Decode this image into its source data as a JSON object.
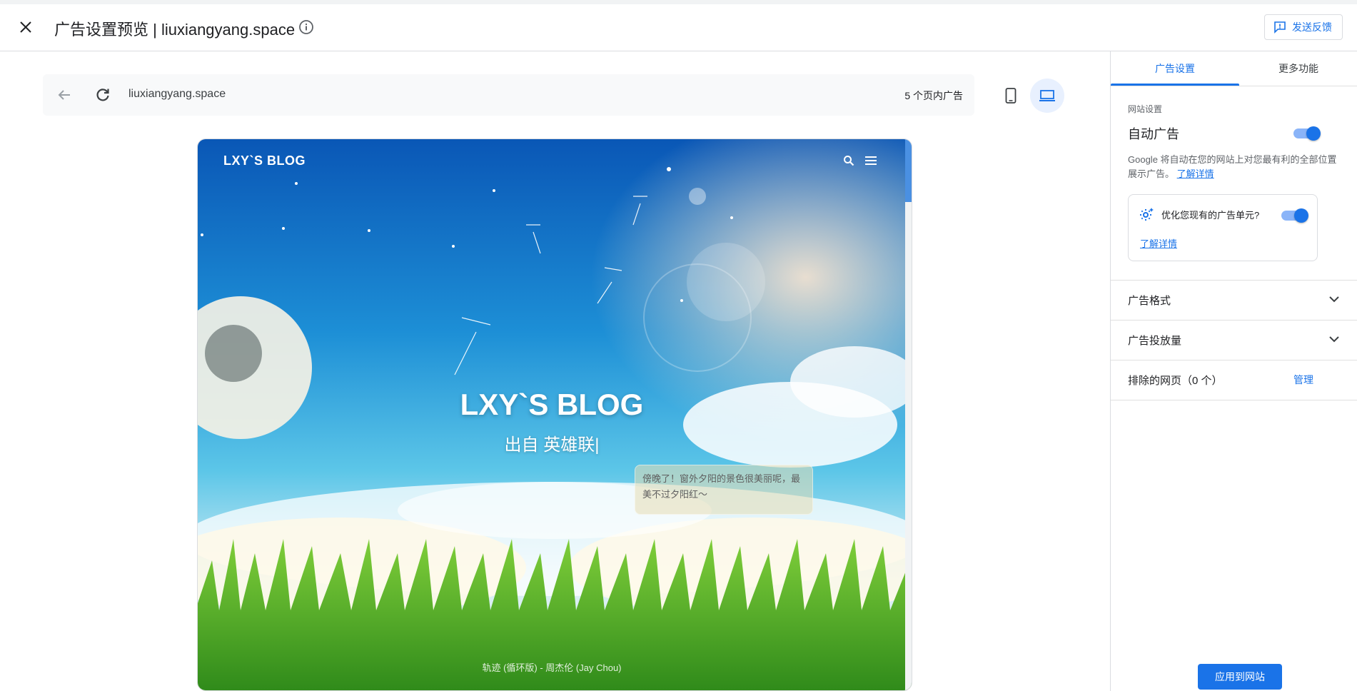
{
  "header": {
    "title": "广告设置预览 | liuxiangyang.space",
    "feedback_label": "发送反馈"
  },
  "preview": {
    "url": "liuxiangyang.space",
    "ad_count": "5 个页内广告",
    "device_selected": "desktop"
  },
  "site": {
    "logo": "LXY`S BLOG",
    "title": "LXY`S BLOG",
    "subtitle": "出自 英雄联|",
    "note": "傍晚了！窗外夕阳的景色很美丽呢，最美不过夕阳红～",
    "music": "轨迹 (循环版) - 周杰伦 (Jay Chou)"
  },
  "panel": {
    "tabs": [
      {
        "label": "广告设置",
        "active": true
      },
      {
        "label": "更多功能",
        "active": false
      }
    ],
    "site_settings_label": "网站设置",
    "auto_ads_label": "自动广告",
    "auto_ads_enabled": true,
    "auto_ads_desc": "Google 将自动在您的网站上对您最有利的全部位置展示广告。",
    "learn_more": "了解详情",
    "optimize_label": "优化您现有的广告单元?",
    "optimize_enabled": true,
    "optimize_learn_more": "了解详情",
    "ad_formats_label": "广告格式",
    "ad_load_label": "广告投放量",
    "excluded_pages_label": "排除的网页（0 个）",
    "manage_label": "管理",
    "apply_label": "应用到网站"
  },
  "colors": {
    "accent": "#1a73e8",
    "accent_light": "#8ab4f8",
    "border": "#dadce0"
  }
}
